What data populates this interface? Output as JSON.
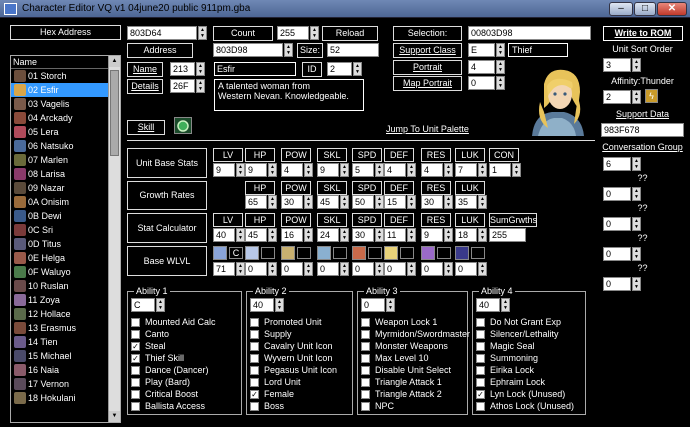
{
  "window": {
    "title": "Character Editor VQ v1 04june20 public 911pm.gba",
    "min": "–",
    "max": "□",
    "close": "✕"
  },
  "left": {
    "hex_address_label": "Hex Address",
    "list_header": "Name",
    "items": [
      {
        "label": "01 Storch",
        "color": "#6b4e3c"
      },
      {
        "label": "02 Esfir",
        "color": "#d8a54a"
      },
      {
        "label": "03 Vagelis",
        "color": "#7a5a4a"
      },
      {
        "label": "04 Arckady",
        "color": "#8a4a3a"
      },
      {
        "label": "05 Lera",
        "color": "#b04a5a"
      },
      {
        "label": "06 Natsuko",
        "color": "#4a6a9a"
      },
      {
        "label": "07 Marlen",
        "color": "#6a6a3a"
      },
      {
        "label": "08 Larisa",
        "color": "#8a3a6a"
      },
      {
        "label": "09 Nazar",
        "color": "#5a4a3a"
      },
      {
        "label": "0A Onisim",
        "color": "#9a6a3a"
      },
      {
        "label": "0B Dewi",
        "color": "#3a5a8a"
      },
      {
        "label": "0C Sri",
        "color": "#7a3a3a"
      },
      {
        "label": "0D Titus",
        "color": "#5a5a7a"
      },
      {
        "label": "0E Helga",
        "color": "#9a5a4a"
      },
      {
        "label": "0F Waluyo",
        "color": "#4a7a4a"
      },
      {
        "label": "10 Ruslan",
        "color": "#6a4a4a"
      },
      {
        "label": "11 Zoya",
        "color": "#8a6a9a"
      },
      {
        "label": "12 Hollace",
        "color": "#5a6a4a"
      },
      {
        "label": "13 Erasmus",
        "color": "#7a4a3a"
      },
      {
        "label": "14 Tien",
        "color": "#6a5a8a"
      },
      {
        "label": "15 Michael",
        "color": "#4a4a6a"
      },
      {
        "label": "16 Naia",
        "color": "#8a5a6a"
      },
      {
        "label": "17 Vernon",
        "color": "#5a4a5a"
      },
      {
        "label": "18 Hokulani",
        "color": "#7a6a4a"
      }
    ]
  },
  "top": {
    "hex_value": "803D64",
    "count_label": "Count",
    "count_value": "255",
    "reload_label": "Reload",
    "selection_label": "Selection:",
    "selection_value": "00803D98",
    "write_label": "Write to ROM",
    "address_label": "Address",
    "address_value": "803D98",
    "size_label": "Size:",
    "size_value": "52",
    "name_label": "Name",
    "name_value": "213",
    "name_text": "Esfir",
    "id_label": "ID",
    "id_value": "2",
    "details_label": "Details",
    "details_value": "26F",
    "details_text": "A talented woman from\nWestern Nevan. Knowledgeable.",
    "support_class_label": "Support Class",
    "support_class_value": "E",
    "support_class_text": "Thief",
    "portrait_label": "Portrait",
    "portrait_value": "4",
    "map_portrait_label": "Map Portrait",
    "map_portrait_value": "0",
    "skill_label": "Skill",
    "jump_label": "Jump To Unit Palette"
  },
  "stats": {
    "base_label": "Unit Base Stats",
    "growth_label": "Growth Rates",
    "calc_label": "Stat Calculator",
    "wlvl_label": "Base WLVL",
    "base_headers": [
      "LV",
      "HP",
      "POW",
      "SKL",
      "SPD",
      "DEF",
      "RES",
      "LUK",
      "CON"
    ],
    "base_values": [
      "9",
      "9",
      "4",
      "9",
      "5",
      "4",
      "4",
      "7",
      "1"
    ],
    "growth_headers": [
      "HP",
      "POW",
      "SKL",
      "SPD",
      "DEF",
      "RES",
      "LUK"
    ],
    "growth_values": [
      "65",
      "30",
      "45",
      "50",
      "15",
      "30",
      "35"
    ],
    "calc_headers": [
      "LV",
      "HP",
      "POW",
      "SKL",
      "SPD",
      "DEF",
      "RES",
      "LUK",
      "SumGrwths"
    ],
    "calc_values": [
      "40",
      "45",
      "16",
      "24",
      "30",
      "11",
      "9",
      "18",
      "255"
    ],
    "wlvl_ranks": [
      "C",
      "",
      "",
      "",
      "",
      "",
      "",
      ""
    ],
    "wlvl_values": [
      "71",
      "0",
      "0",
      "0",
      "0",
      "0",
      "0",
      "0"
    ]
  },
  "abilities": [
    {
      "title": "Ability 1",
      "value": "C",
      "items": [
        {
          "label": "Mounted Aid Calc",
          "checked": false
        },
        {
          "label": "Canto",
          "checked": false
        },
        {
          "label": "Steal",
          "checked": true
        },
        {
          "label": "Thief Skill",
          "checked": true
        },
        {
          "label": "Dance (Dancer)",
          "checked": false
        },
        {
          "label": "Play (Bard)",
          "checked": false
        },
        {
          "label": "Critical Boost",
          "checked": false
        },
        {
          "label": "Ballista Access",
          "checked": false
        }
      ]
    },
    {
      "title": "Ability 2",
      "value": "40",
      "items": [
        {
          "label": "Promoted Unit",
          "checked": false
        },
        {
          "label": "Supply",
          "checked": false
        },
        {
          "label": "Cavalry Unit Icon",
          "checked": false
        },
        {
          "label": "Wyvern Unit Icon",
          "checked": false
        },
        {
          "label": "Pegasus Unit Icon",
          "checked": false
        },
        {
          "label": "Lord Unit",
          "checked": false
        },
        {
          "label": "Female",
          "checked": true
        },
        {
          "label": "Boss",
          "checked": false
        }
      ]
    },
    {
      "title": "Ability 3",
      "value": "0",
      "items": [
        {
          "label": "Weapon Lock 1",
          "checked": false
        },
        {
          "label": "Myrmidon/Swordmaster",
          "checked": false
        },
        {
          "label": "Monster Weapons",
          "checked": false
        },
        {
          "label": "Max Level 10",
          "checked": false
        },
        {
          "label": "Disable Unit Select",
          "checked": false
        },
        {
          "label": "Triangle Attack 1",
          "checked": false
        },
        {
          "label": "Triangle Attack 2",
          "checked": false
        },
        {
          "label": "NPC",
          "checked": false
        }
      ]
    },
    {
      "title": "Ability 4",
      "value": "40",
      "items": [
        {
          "label": "Do Not Grant Exp",
          "checked": false
        },
        {
          "label": "Silencer/Lethality",
          "checked": false
        },
        {
          "label": "Magic Seal",
          "checked": false
        },
        {
          "label": "Summoning",
          "checked": false
        },
        {
          "label": "Eirika Lock",
          "checked": false
        },
        {
          "label": "Ephraim Lock",
          "checked": false
        },
        {
          "label": "Lyn Lock (Unused)",
          "checked": true
        },
        {
          "label": "Athos Lock (Unused)",
          "checked": false
        }
      ]
    }
  ],
  "right": {
    "sort_label": "Unit Sort Order",
    "sort_value": "3",
    "affinity_label": "Affinity:Thunder",
    "affinity_value": "2",
    "support_label": "Support Data",
    "support_value": "983F678",
    "conv_label": "Conversation Group",
    "conv_values": [
      "6",
      "??",
      "0",
      "??",
      "0",
      "??",
      "0",
      "??",
      "0"
    ]
  },
  "colors": {
    "selected": "#3399ff",
    "background": "#000000"
  }
}
